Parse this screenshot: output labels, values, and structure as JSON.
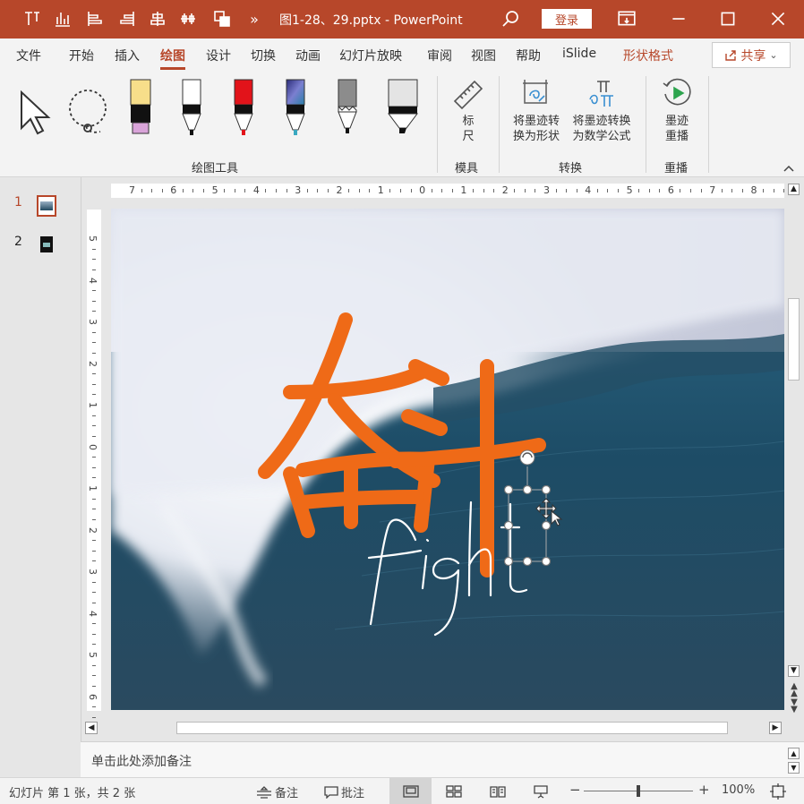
{
  "titlebar": {
    "title": "图1-28、29.pptx  -  PowerPoint",
    "login_label": "登录",
    "more_label": "»",
    "quick_access_icons": [
      "text-direction-icon",
      "chart-icon",
      "align-left-icon",
      "align-right-icon",
      "align-center-icon",
      "distribute-icon",
      "arrange-icon"
    ]
  },
  "tabs": [
    {
      "label": "文件"
    },
    {
      "label": "开始"
    },
    {
      "label": "插入"
    },
    {
      "label": "绘图",
      "active": true
    },
    {
      "label": "设计"
    },
    {
      "label": "切换"
    },
    {
      "label": "动画"
    },
    {
      "label": "幻灯片放映"
    },
    {
      "label": "审阅"
    },
    {
      "label": "视图"
    },
    {
      "label": "帮助"
    },
    {
      "label": "iSlide"
    },
    {
      "label": "形状格式",
      "context": true
    }
  ],
  "share_label": "共享",
  "ribbon": {
    "groups": {
      "drawing_tools": "绘图工具",
      "stencils": "模具",
      "convert": "转换",
      "replay": "重播"
    },
    "ruler_btn": [
      "标",
      "尺"
    ],
    "ink_to_shape": [
      "将墨迹转",
      "换为形状"
    ],
    "ink_to_math": [
      "将墨迹转换",
      "为数学公式"
    ],
    "ink_replay": [
      "墨迹",
      "重播"
    ],
    "pens": [
      {
        "name": "highlighter-yellow",
        "color": "#f7de8a",
        "cap": "#d9a4d9"
      },
      {
        "name": "pen-white",
        "color": "#ffffff"
      },
      {
        "name": "pen-red",
        "color": "#e2131a"
      },
      {
        "name": "pen-galaxy",
        "color": "#6a6fb3",
        "tip": "#3aa8c0"
      },
      {
        "name": "pen-gray",
        "color": "#8c8c8c"
      },
      {
        "name": "pen-lightgray",
        "color": "#e4e4e4"
      }
    ]
  },
  "slides": [
    {
      "number": "1",
      "selected": true
    },
    {
      "number": "2",
      "selected": false
    }
  ],
  "hruler_labels": [
    "7",
    "6",
    "5",
    "4",
    "3",
    "2",
    "1",
    "0",
    "1",
    "2",
    "3",
    "4",
    "5",
    "6",
    "7",
    "8"
  ],
  "vruler_labels": [
    "5",
    "4",
    "3",
    "2",
    "1",
    "0",
    "1",
    "2",
    "3",
    "4",
    "5",
    "6"
  ],
  "slide": {
    "ink_main_text": "奋斗",
    "ink_main_color": "#ef6a17",
    "ink_sub_text": "fight",
    "ink_sub_color": "#ffffff"
  },
  "notes_placeholder": "单击此处添加备注",
  "status": {
    "slide_info": "幻灯片 第 1 张，共 2 张",
    "notes_btn": "备注",
    "comments_btn": "批注",
    "zoom_minus": "−",
    "zoom_plus": "+",
    "zoom_level": "100%",
    "zoom_fraction": 0.5
  },
  "colors": {
    "accent": "#b7472a"
  }
}
